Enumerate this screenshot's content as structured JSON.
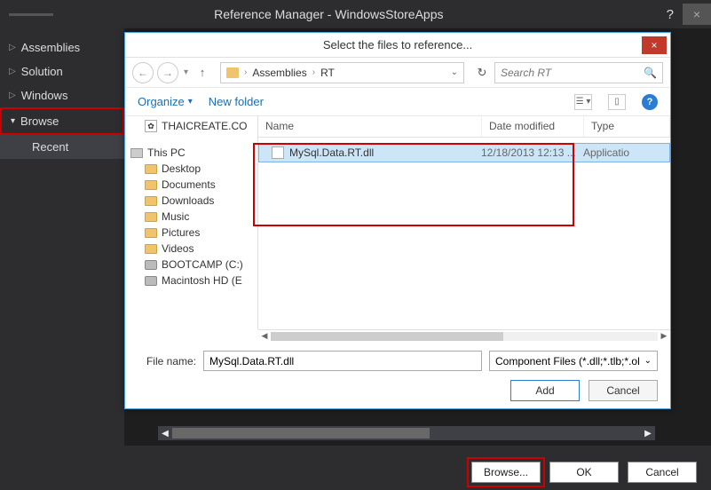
{
  "outer": {
    "title": "Reference Manager - WindowsStoreApps",
    "help": "?",
    "close": "×",
    "sidebar": {
      "items": [
        {
          "label": "Assemblies",
          "expanded": false
        },
        {
          "label": "Solution",
          "expanded": false
        },
        {
          "label": "Windows",
          "expanded": false
        },
        {
          "label": "Browse",
          "expanded": true
        }
      ],
      "sub": "Recent"
    },
    "buttons": {
      "browse": "Browse...",
      "ok": "OK",
      "cancel": "Cancel"
    }
  },
  "dialog": {
    "title": "Select the files to reference...",
    "close": "×",
    "nav": {
      "back": "←",
      "fwd": "→",
      "up": "↑",
      "refresh": "↻",
      "crumbs": [
        "Assemblies",
        "RT"
      ],
      "search_placeholder": "Search RT"
    },
    "toolbar": {
      "organize": "Organize",
      "newfolder": "New folder",
      "help": "?"
    },
    "tree": {
      "thai": "THAICREATE.CO",
      "pc": "This PC",
      "folders": [
        "Desktop",
        "Documents",
        "Downloads",
        "Music",
        "Pictures",
        "Videos"
      ],
      "drives": [
        "BOOTCAMP (C:)",
        "Macintosh HD (E"
      ]
    },
    "list": {
      "cols": {
        "name": "Name",
        "date": "Date modified",
        "type": "Type"
      },
      "files": [
        {
          "name": "MySql.Data.RT.dll",
          "date": "12/18/2013 12:13 ...",
          "type": "Applicatio"
        }
      ]
    },
    "bottom": {
      "filename_label": "File name:",
      "filename_value": "MySql.Data.RT.dll",
      "filter": "Component Files (*.dll;*.tlb;*.ol",
      "add": "Add",
      "cancel": "Cancel"
    }
  }
}
